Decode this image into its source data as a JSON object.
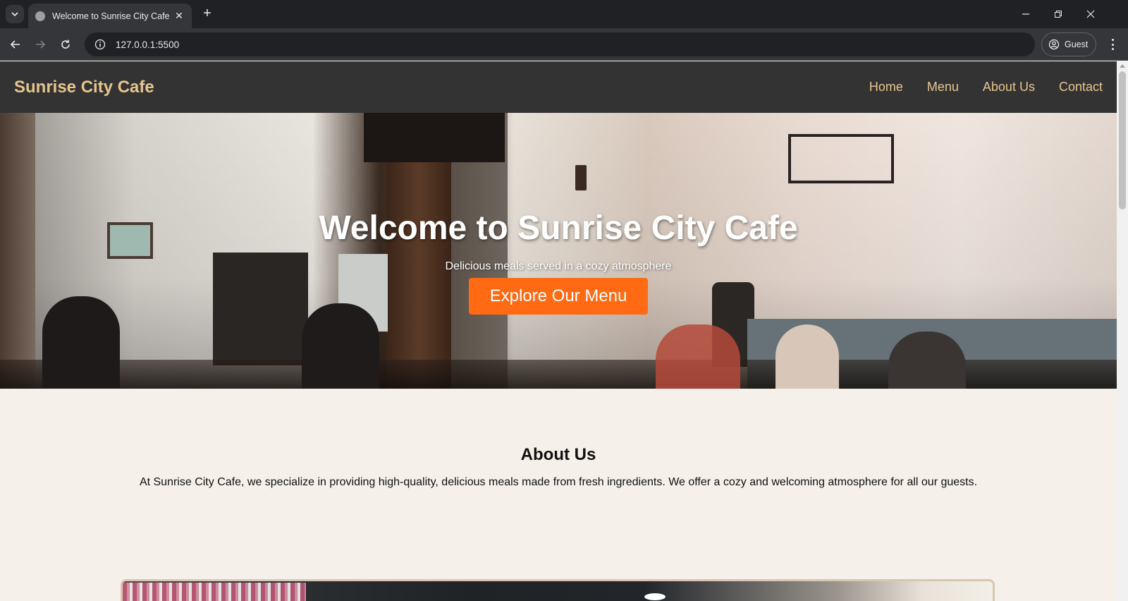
{
  "browser": {
    "tab_title": "Welcome to Sunrise City Cafe",
    "url": "127.0.0.1:5500",
    "profile_label": "Guest"
  },
  "site": {
    "logo": "Sunrise City Cafe",
    "nav": [
      "Home",
      "Menu",
      "About Us",
      "Contact"
    ]
  },
  "hero": {
    "title": "Welcome to Sunrise City Cafe",
    "subtitle": "Delicious meals served in a cozy atmosphere",
    "cta_label": "Explore Our Menu"
  },
  "about": {
    "title": "About Us",
    "text": "At Sunrise City Cafe, we specialize in providing high-quality, delicious meals made from fresh ingredients. We offer a cozy and welcoming atmosphere for all our guests."
  },
  "colors": {
    "header_bg": "#333333",
    "accent": "#e8c48f",
    "cta": "#ff6a13",
    "page_bg": "#f5f0ea"
  }
}
